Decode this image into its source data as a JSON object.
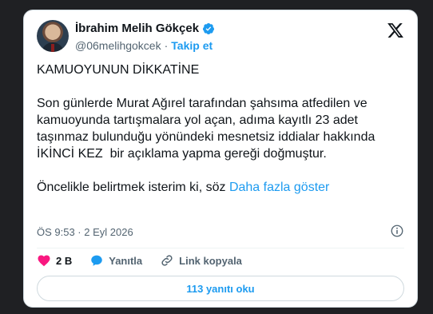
{
  "author": {
    "name": "İbrahim Melih Gökçek",
    "handle": "@06melihgokcek",
    "separator": "·",
    "follow_label": "Takip et"
  },
  "tweet": {
    "paragraphs": [
      "KAMUOYUNUN DİKKATİNE",
      "Son günlerde Murat Ağırel tarafından şahsıma atfedilen ve kamuoyunda tartışmalara yol açan, adıma kayıtlı 23 adet taşınmaz bulunduğu yönündeki mesnetsiz iddialar hakkında İKİNCİ KEZ  bir açıklama yapma gereği doğmuştur.",
      "Öncelikle belirtmek isterim ki, söz"
    ],
    "show_more": "Daha fazla göster",
    "timestamp": "ÖS 9:53 · 2 Eyl 2026"
  },
  "actions": {
    "likes": "2 B",
    "reply_label": "Yanıtla",
    "copy_link_label": "Link kopyala"
  },
  "replies_button": "113 yanıtı oku",
  "colors": {
    "accent": "#1d9bf0",
    "like": "#f91880",
    "muted": "#536471",
    "text": "#0f1419"
  },
  "icons": [
    "x-logo-icon",
    "verified-badge-icon",
    "info-icon",
    "heart-icon",
    "reply-bubble-icon",
    "link-icon"
  ]
}
